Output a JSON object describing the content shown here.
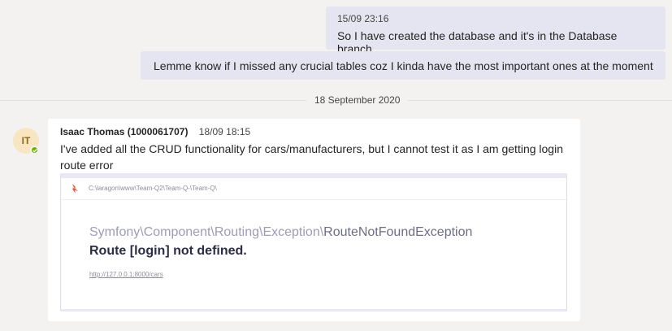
{
  "messages_self": [
    {
      "timestamp": "15/09 23:16",
      "text": "So I have created the database and it's in the Database branch."
    },
    {
      "text": "Lemme know if I missed any crucial tables coz I kinda have the most important ones at the moment"
    }
  ],
  "date_divider": "18 September 2020",
  "incoming": {
    "avatar_initials": "IT",
    "presence": "available",
    "sender": "Isaac Thomas (1000061707)",
    "timestamp": "18/09 18:15",
    "text": "I've added all the CRUD functionality for cars/manufacturers, but I cannot test it as I am getting login route error",
    "screenshot": {
      "path": "C:\\laragon\\www\\Team-Q2\\Team-Q-\\Team-Q\\",
      "exception_namespace": "Symfony\\Component\\Routing\\Exception\\",
      "exception_class": "RouteNotFoundException",
      "message": "Route [login] not defined.",
      "url": "http://127.0.0.1:8000/cars"
    }
  },
  "colors": {
    "self_bubble": "#e5e5f1",
    "background": "#f3f2f1",
    "presence_available": "#6bb700"
  }
}
